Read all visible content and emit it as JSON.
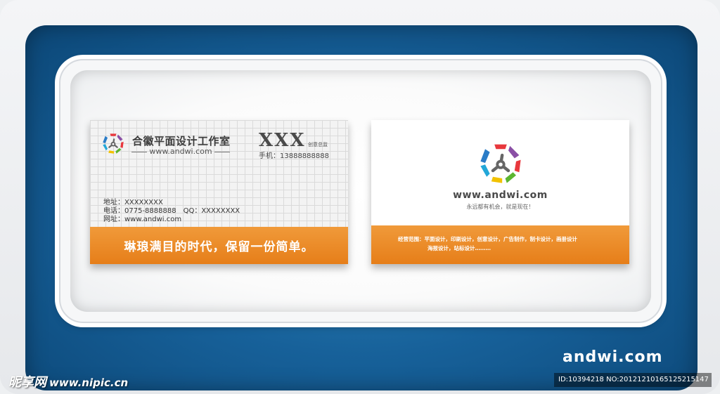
{
  "front_card": {
    "studio_name": "合徽平面设计工作室",
    "studio_url": "www.andwi.com",
    "person_name": "XXX",
    "person_title": "创意总监",
    "phone": "手机：13888888888",
    "address": "地址：XXXXXXXX",
    "tel": "电话：0775-8888888",
    "qq": "QQ：XXXXXXXX",
    "website": "网址：www.andwi.com",
    "slogan": "琳琅满目的时代，保留一份简单。"
  },
  "back_card": {
    "url": "www.andwi.com",
    "tagline": "永远都有机会，就是现在！",
    "services_line1": "经营范围：平面设计，印刷设计，创意设计，广告制作，制卡设计，画册设计",
    "services_line2": "海报设计，站标设计………"
  },
  "brand_mark": "andwi.com",
  "watermark": {
    "site_name": "昵享网",
    "site_url": "www.nipic.cn",
    "id_text": "ID:10394218 NO:20121210165125215147"
  },
  "colors": {
    "orange": "#e67e19",
    "blue": "#17619a",
    "logo_blue": "#2a7cc7",
    "logo_red": "#e8383d",
    "logo_purple": "#8a4fa5",
    "logo_green": "#5cb531",
    "logo_yellow": "#f2c200",
    "logo_cyan": "#22a7d8"
  },
  "icons": [
    "andwi-logo-icon"
  ]
}
